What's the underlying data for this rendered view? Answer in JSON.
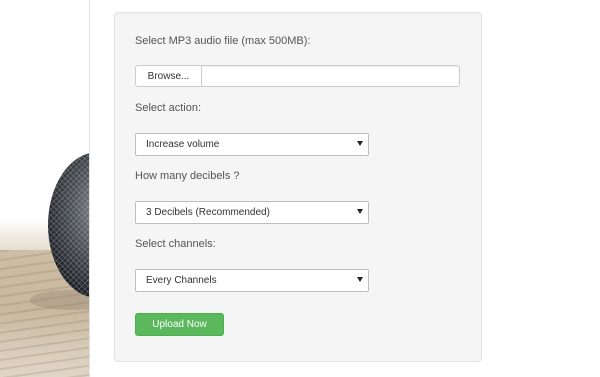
{
  "form": {
    "file_label": "Select MP3 audio file (max 500MB):",
    "browse_label": "Browse...",
    "file_value": "",
    "action_label": "Select action:",
    "action_value": "Increase volume",
    "decibels_label": "How many decibels ?",
    "decibels_value": "3 Decibels (Recommended)",
    "channels_label": "Select channels:",
    "channels_value": "Every Channels",
    "upload_label": "Upload Now"
  },
  "colors": {
    "upload_button": "#5cb85c",
    "well_background": "#f5f5f5"
  },
  "background": {
    "image": "microphone-on-sand"
  }
}
